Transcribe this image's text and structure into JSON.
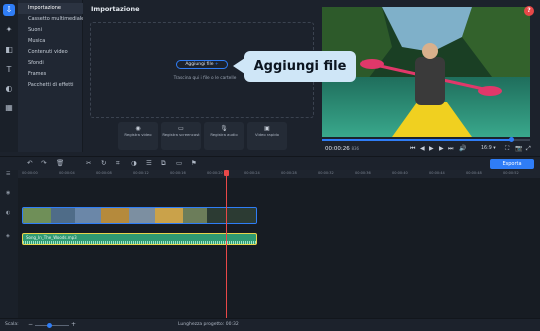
{
  "rail": {
    "icons": [
      {
        "name": "import-icon",
        "glyph": "⇩"
      },
      {
        "name": "magic-wand-icon",
        "glyph": "✦"
      },
      {
        "name": "transitions-icon",
        "glyph": "◧"
      },
      {
        "name": "titles-icon",
        "glyph": "T"
      },
      {
        "name": "filters-icon",
        "glyph": "◐"
      },
      {
        "name": "more-tools-icon",
        "glyph": "▦"
      }
    ]
  },
  "menu": {
    "items": [
      "Importazione",
      "Cassetto multimediale",
      "Suoni",
      "Musica",
      "Contenuti video",
      "Sfondi",
      "Frames",
      "Pacchetti di effetti"
    ]
  },
  "import": {
    "title": "Importazione",
    "add_button": "Aggiungi file",
    "drop_hint": "Trascina qui i file o le cartelle",
    "quick_buttons": [
      {
        "icon": "camera-icon",
        "glyph": "◉",
        "label": "Registra video"
      },
      {
        "icon": "screen-record-icon",
        "glyph": "▭",
        "label": "Registra screencast"
      },
      {
        "icon": "microphone-icon",
        "glyph": "🎙",
        "label": "Registra audio"
      },
      {
        "icon": "video-quick-icon",
        "glyph": "▣",
        "label": "Video rapido"
      }
    ]
  },
  "callout": {
    "text": "Aggiungi file"
  },
  "preview": {
    "timecode": "00:00:26",
    "timecode_ms": "836",
    "progress": 0.91,
    "aspect_ratio": "16:9 ▾",
    "controls": [
      "⏮",
      "◀",
      "▶",
      "▶",
      "⏭",
      "🔊"
    ],
    "right_controls": [
      "⛶",
      "📷",
      "⤢"
    ]
  },
  "toolbar": {
    "icons": [
      {
        "name": "undo-icon",
        "glyph": "↶"
      },
      {
        "name": "redo-icon",
        "glyph": "↷"
      },
      {
        "name": "delete-icon",
        "glyph": "🗑"
      },
      {
        "name": "cut-icon",
        "glyph": "✂"
      },
      {
        "name": "rotate-icon",
        "glyph": "↻"
      },
      {
        "name": "crop-icon",
        "glyph": "⌗"
      },
      {
        "name": "adjust-icon",
        "glyph": "◑"
      },
      {
        "name": "properties-icon",
        "glyph": "☰"
      },
      {
        "name": "stabilize-icon",
        "glyph": "⧉"
      },
      {
        "name": "monitor-icon",
        "glyph": "▭"
      },
      {
        "name": "flag-icon",
        "glyph": "⚑"
      }
    ],
    "export_label": "Esporta"
  },
  "timeline": {
    "ruler_ticks": [
      "00:00:00",
      "00:00:04",
      "00:00:08",
      "00:00:12",
      "00:00:16",
      "00:00:20",
      "00:00:24",
      "00:00:28",
      "00:00:32",
      "00:00:36",
      "00:00:40",
      "00:00:44",
      "00:00:48",
      "00:00:52"
    ],
    "audio_clip_name": "Song_In_The_Woods.mp3"
  },
  "status": {
    "scale_label": "Scala:",
    "duration_label": "Lunghezza progetto: 00:32"
  },
  "colors": {
    "accent": "#2f7df6",
    "playhead": "#e84848",
    "audio_clip": "#2f9a72",
    "audio_border": "#e9d44a",
    "callout_bg": "#cfe6f7",
    "kayak": "#f0d020",
    "paddle": "#e0386a"
  }
}
